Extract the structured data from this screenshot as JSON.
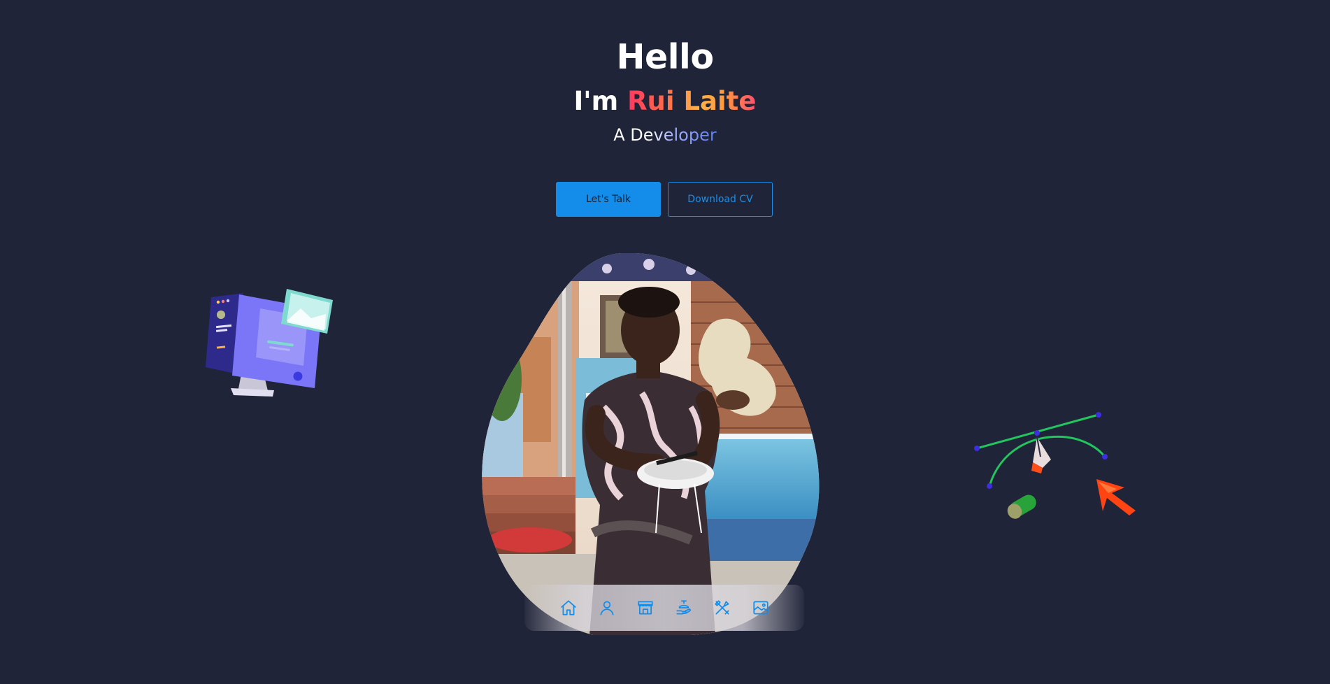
{
  "hero": {
    "greeting": "Hello",
    "intro_prefix": "I'm ",
    "name": "Rui Laite",
    "role": "A Developer"
  },
  "actions": {
    "talk_label": "Let's Talk",
    "cv_label": "Download CV"
  },
  "nav": {
    "items": [
      {
        "icon": "home-icon"
      },
      {
        "icon": "user-icon"
      },
      {
        "icon": "store-icon"
      },
      {
        "icon": "hand-service-icon"
      },
      {
        "icon": "tools-icon"
      },
      {
        "icon": "image-icon"
      }
    ]
  },
  "colors": {
    "background": "#202438",
    "accent": "#138de9",
    "name_gradient_start": "#ff3860",
    "name_gradient_end": "#ffb347",
    "role_gradient": "#5b7bf2"
  }
}
